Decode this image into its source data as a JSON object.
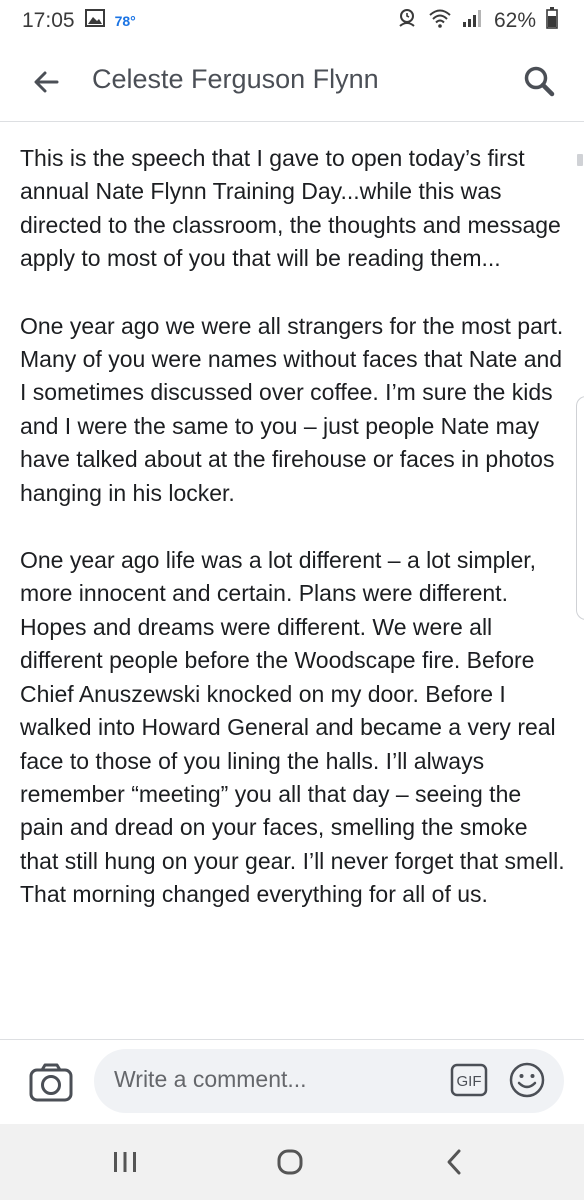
{
  "status_bar": {
    "time": "17:05",
    "temperature": "78°",
    "battery": "62%",
    "icons": [
      "image-icon",
      "alarm-icon",
      "wifi-icon",
      "signal-icon",
      "battery-icon"
    ]
  },
  "header": {
    "title": "Celeste Ferguson Flynn",
    "back_icon": "back-arrow-icon",
    "search_icon": "search-icon"
  },
  "post": {
    "paragraphs": [
      "This is the speech that I gave to open today’s first annual Nate Flynn Training Day...while this was directed to the classroom, the thoughts and message apply to most of you that will be reading them...",
      "One year ago we were all strangers for the most part. Many of you were names without faces that Nate and I sometimes discussed over coffee. I’m sure the kids and I were the same to you – just people Nate may have talked about at the firehouse or faces in photos hanging in his locker.",
      "One year ago life was a lot different – a lot simpler, more innocent and certain. Plans were different. Hopes and dreams were different. We were all different people before the Woodscape fire. Before Chief Anuszewski knocked on my door. Before I walked into Howard General and became a very real face to those of you lining the halls. I’ll always remember “meeting” you all that day – seeing the pain and dread on your faces, smelling the smoke that still hung on your gear. I’ll never forget that smell. That morning changed everything for all of us."
    ]
  },
  "comment_bar": {
    "placeholder": "Write a comment...",
    "gif_label": "GIF",
    "icons": [
      "camera-icon",
      "gif-icon",
      "emoji-icon"
    ]
  },
  "nav_bar": {
    "icons": [
      "recent-apps-icon",
      "home-icon",
      "back-icon"
    ]
  },
  "colors": {
    "accent": "#1b74e4",
    "text": "#1c1e21",
    "muted": "#65676b",
    "input_bg": "#f0f2f5"
  }
}
